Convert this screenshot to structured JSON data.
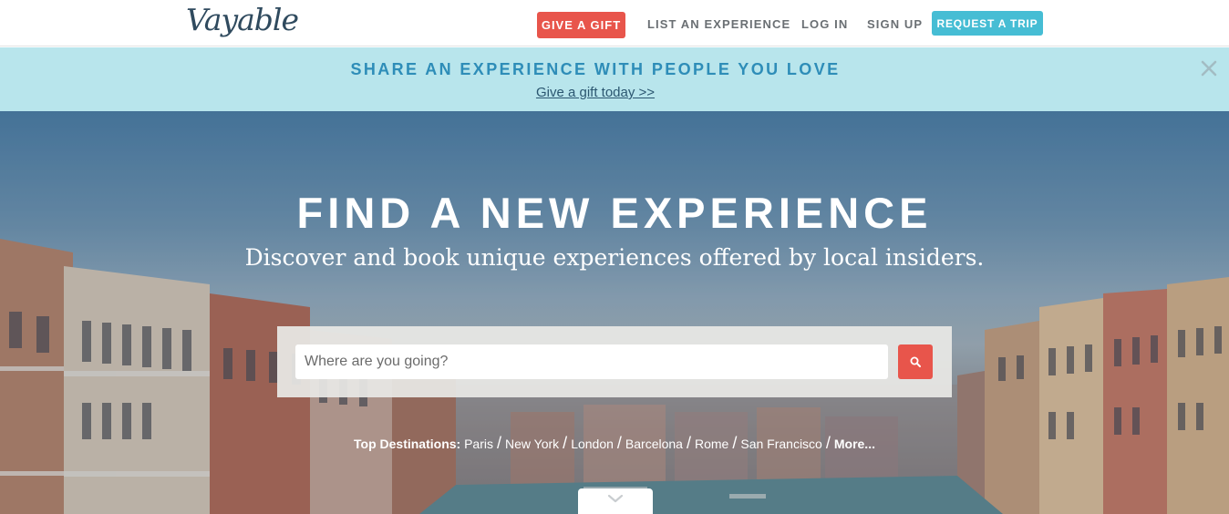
{
  "nav": {
    "logo": "Vayable",
    "give_gift": "GIVE A GIFT",
    "list_experience": "LIST AN EXPERIENCE",
    "log_in": "LOG IN",
    "sign_up": "SIGN UP",
    "request_trip": "REQUEST A TRIP"
  },
  "banner": {
    "headline": "SHARE AN EXPERIENCE WITH PEOPLE YOU LOVE",
    "link": "Give a gift today >>",
    "close_icon": "close-icon"
  },
  "hero": {
    "title": "FIND A NEW EXPERIENCE",
    "subtitle": "Discover and book unique experiences offered by local insiders.",
    "search_placeholder": "Where are you going?",
    "search_icon": "search-icon",
    "destinations_label": "Top Destinations:",
    "destinations": [
      "Paris",
      "New York",
      "London",
      "Barcelona",
      "Rome",
      "San Francisco"
    ],
    "more": "More...",
    "scroll_icon": "chevron-down-icon"
  },
  "colors": {
    "accent_red": "#e8554b",
    "accent_teal": "#46bdd4",
    "banner_bg": "#b8e5ec",
    "banner_text": "#2e8db8"
  }
}
